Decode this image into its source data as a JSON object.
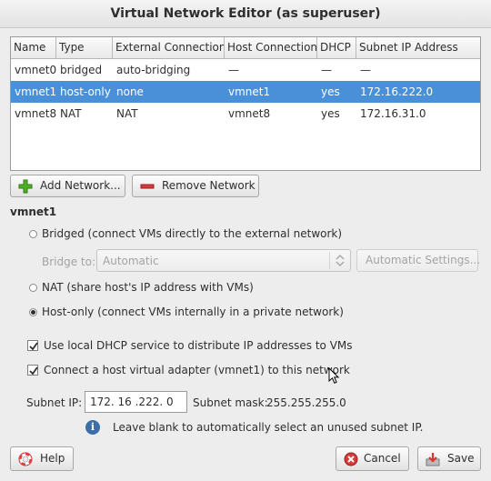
{
  "window": {
    "title": "Virtual Network Editor (as superuser)"
  },
  "table": {
    "headers": [
      "Name",
      "Type",
      "External Connection",
      "Host Connection",
      "DHCP",
      "Subnet IP Address"
    ],
    "rows": [
      [
        "vmnet0",
        "bridged",
        "auto-bridging",
        "—",
        "—",
        "—"
      ],
      [
        "vmnet1",
        "host-only",
        "none",
        "vmnet1",
        "yes",
        "172.16.222.0"
      ],
      [
        "vmnet8",
        "NAT",
        "NAT",
        "vmnet8",
        "yes",
        "172.16.31.0"
      ]
    ],
    "selected_row": 1
  },
  "actions": {
    "add_network": "Add Network...",
    "remove_network": "Remove Network"
  },
  "selected_network": {
    "name": "vmnet1"
  },
  "options": {
    "bridged_label": "Bridged (connect VMs directly to the external network)",
    "bridge_to_label": "Bridge to:",
    "bridge_to_value": "Automatic",
    "automatic_settings": "Automatic Settings...",
    "nat_label": "NAT (share host's IP address with VMs)",
    "host_only_label": "Host-only (connect VMs internally in a private network)",
    "selected_mode": "host-only",
    "dhcp_label": "Use local DHCP service to distribute IP addresses to VMs",
    "dhcp_checked": true,
    "adapter_label": "Connect a host virtual adapter (vmnet1) to this network",
    "adapter_checked": true
  },
  "subnet": {
    "ip_label": "Subnet IP:",
    "ip_value": "172. 16 .222.  0",
    "mask_label": "Subnet mask:",
    "mask_value": "255.255.255.0",
    "hint": "Leave blank to automatically select an unused subnet IP."
  },
  "footer": {
    "help": "Help",
    "cancel": "Cancel",
    "save": "Save"
  },
  "colors": {
    "selection": "#4a90d9",
    "add_icon": "#4caf26",
    "remove_icon": "#d23c3c"
  }
}
